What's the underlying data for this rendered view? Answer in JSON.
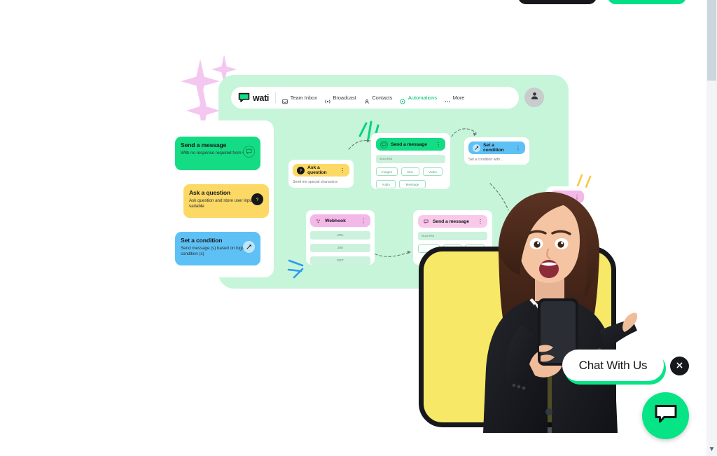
{
  "topbar": {
    "dark_button_label": "",
    "green_button_label": ""
  },
  "scrollbar": {
    "arrow_icon": "chevron-down-icon"
  },
  "navbar": {
    "logo_text": "wati",
    "logo_icon": "chat-bubble-logo-icon",
    "avatar_icon": "person-icon",
    "items": [
      {
        "label": "Team Inbox",
        "icon": "inbox-icon",
        "active": false
      },
      {
        "label": "Broadcast",
        "icon": "broadcast-icon",
        "active": false
      },
      {
        "label": "Contacts",
        "icon": "contacts-icon",
        "active": false
      },
      {
        "label": "Automations",
        "icon": "automation-icon",
        "active": true
      },
      {
        "label": "More",
        "icon": "more-dots-icon",
        "active": false
      }
    ]
  },
  "palette_cards": [
    {
      "title": "Send a message",
      "subtitle": "With no response required from visitor",
      "icon": "message-bubble-icon",
      "color": "#14dc84"
    },
    {
      "title": "Ask a question",
      "subtitle": "Ask question and store user input in variable",
      "icon": "question-mark-icon",
      "color": "#fcd864"
    },
    {
      "title": "Set a condition",
      "subtitle": "Send message (s) based on logical condition (s)",
      "icon": "branch-icon",
      "color": "#5ec1f5"
    }
  ],
  "flow_nodes": {
    "ask_question": {
      "title": "Ask a question",
      "icon": "question-mark-icon",
      "menu_icon": "kebab-menu-icon",
      "subtitle": "Send me special characters",
      "header_color": "#fcd864"
    },
    "send_message_1": {
      "title": "Send a message",
      "icon": "message-bubble-icon",
      "menu_icon": "kebab-menu-icon",
      "field_value": "Success",
      "chips": [
        "Images",
        "Doc",
        "Video",
        "Audio",
        "Message"
      ],
      "header_color": "#14dc84"
    },
    "set_condition": {
      "title": "Set a condition",
      "icon": "branch-icon",
      "menu_icon": "kebab-menu-icon",
      "subtitle": "Set a condition with ..",
      "header_color": "#5ec1f5"
    },
    "webhook": {
      "title": "Webhook",
      "icon": "webhook-icon",
      "menu_icon": "kebab-menu-icon",
      "rows": [
        "URL",
        "200",
        "GET"
      ],
      "header_color": "#f4b8e8"
    },
    "send_message_2": {
      "title": "Send a message",
      "icon": "message-bubble-icon",
      "menu_icon": "kebab-menu-icon",
      "field_value": "Success",
      "header_color": "#f8c9e8"
    },
    "partial_right": {
      "title": "",
      "menu_icon": "kebab-menu-icon",
      "header_color": "#f4b8e8"
    }
  },
  "chat_widget": {
    "pill_label": "Chat With Us",
    "close_icon": "close-x-icon",
    "fab_icon": "chat-bubble-icon",
    "fab_color": "#06e486"
  },
  "decorations": {
    "sparkle_icon": "sparkle-star-icon",
    "sparkle_color": "#f3c7f0",
    "burst_green_color": "#06d47e",
    "burst_blue_color": "#2d9bf0",
    "burst_yellow_color": "#f7c948"
  }
}
